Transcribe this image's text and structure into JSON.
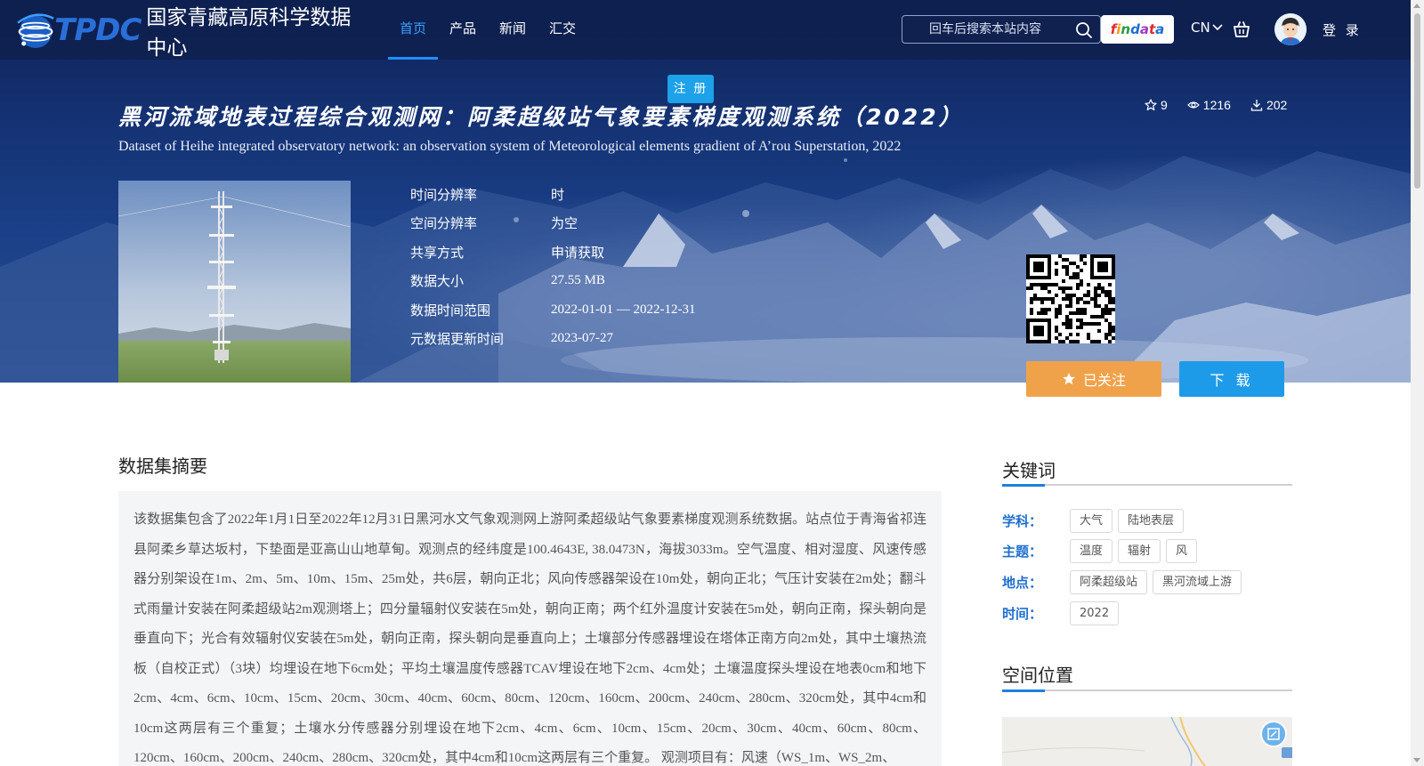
{
  "nav": {
    "logo_letters": "TPDC",
    "logo_cn": "国家青藏高原科学数据中心",
    "menu": [
      {
        "label": "首页",
        "active": true
      },
      {
        "label": "产品",
        "active": false
      },
      {
        "label": "新闻",
        "active": false
      },
      {
        "label": "汇交",
        "active": false
      }
    ],
    "search_placeholder": "回车后搜索本站内容",
    "search_icon": "search-icon",
    "findata_label": "findata",
    "lang": "CN",
    "cart_icon": "cart-icon",
    "login": "登 录",
    "register": "注 册"
  },
  "dataset": {
    "title_cn": "黑河流域地表过程综合观测网：阿柔超级站气象要素梯度观测系统（2022）",
    "title_en": "Dataset of Heihe integrated observatory network: an observation system of Meteorological elements gradient of A’rou Superstation, 2022",
    "stats": {
      "favorites": "9",
      "views": "1216",
      "downloads": "202"
    },
    "meta": [
      {
        "key": "时间分辨率",
        "value": "时"
      },
      {
        "key": "空间分辨率",
        "value": "为空"
      },
      {
        "key": "共享方式",
        "value": "申请获取"
      },
      {
        "key": "数据大小",
        "value": "27.55 MB"
      },
      {
        "key": "数据时间范围",
        "value": "2022-01-01 — 2022-12-31"
      },
      {
        "key": "元数据更新时间",
        "value": "2023-07-27"
      }
    ],
    "follow_label": "已关注",
    "download_label": "下 载"
  },
  "abstract": {
    "title": "数据集摘要",
    "text": "该数据集包含了2022年1月1日至2022年12月31日黑河水文气象观测网上游阿柔超级站气象要素梯度观测系统数据。站点位于青海省祁连县阿柔乡草达坂村，下垫面是亚高山山地草甸。观测点的经纬度是100.4643E, 38.0473N，海拔3033m。空气温度、相对湿度、风速传感器分别架设在1m、2m、5m、10m、15m、25m处，共6层，朝向正北；风向传感器架设在10m处，朝向正北；气压计安装在2m处；翻斗式雨量计安装在阿柔超级站2m观测塔上；四分量辐射仪安装在5m处，朝向正南；两个红外温度计安装在5m处，朝向正南，探头朝向是垂直向下；光合有效辐射仪安装在5m处，朝向正南，探头朝向是垂直向上；土壤部分传感器埋设在塔体正南方向2m处，其中土壤热流板（自校正式）（3块）均埋设在地下6cm处；平均土壤温度传感器TCAV埋设在地下2cm、4cm处；土壤温度探头埋设在地表0cm和地下2cm、4cm、6cm、10cm、15cm、20cm、30cm、40cm、60cm、80cm、120cm、160cm、200cm、240cm、280cm、320cm处，其中4cm和10cm这两层有三个重复；土壤水分传感器分别埋设在地下2cm、4cm、6cm、10cm、15cm、20cm、30cm、40cm、60cm、80cm、120cm、160cm、200cm、240cm、280cm、320cm处，其中4cm和10cm这两层有三个重复。 观测项目有：风速（WS_1m、WS_2m、"
  },
  "sidebar": {
    "keywords_title": "关键词",
    "keyword_groups": [
      {
        "label": "学科：",
        "tags": [
          "大气",
          "陆地表层"
        ]
      },
      {
        "label": "主题：",
        "tags": [
          "温度",
          "辐射",
          "风"
        ]
      },
      {
        "label": "地点：",
        "tags": [
          "阿柔超级站",
          "黑河流域上游"
        ]
      },
      {
        "label": "时间：",
        "tags": [
          "2022"
        ]
      }
    ],
    "location_title": "空间位置"
  },
  "colors": {
    "nav_active": "#3aa0ff",
    "follow_btn": "#f0a24a",
    "download_btn": "#1e9be8",
    "register_btn": "#1da1e8",
    "keyword_label": "#1e6fd0"
  }
}
